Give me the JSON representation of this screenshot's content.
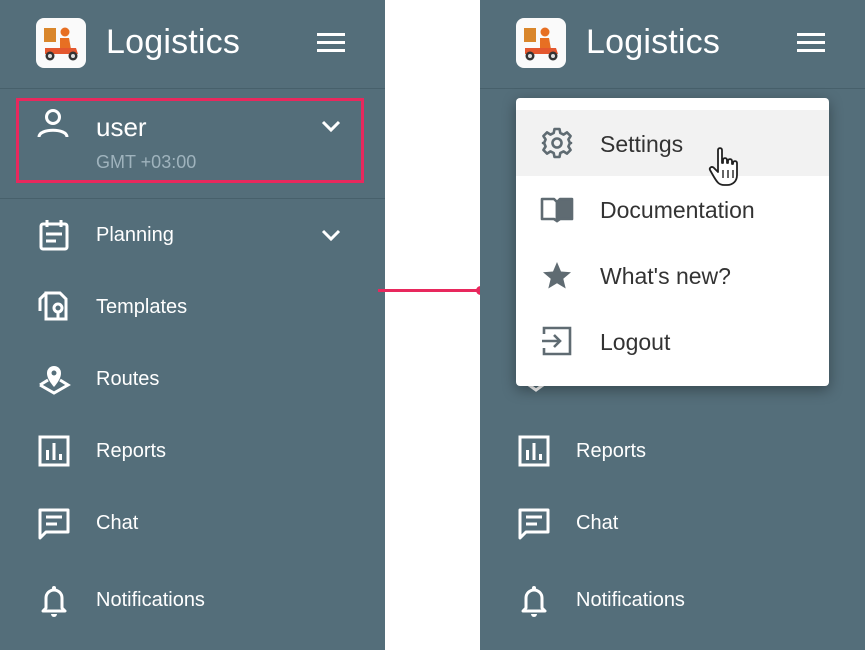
{
  "app": {
    "title": "Logistics"
  },
  "user": {
    "name": "user",
    "timezone": "GMT +03:00"
  },
  "nav": {
    "planning": "Planning",
    "templates": "Templates",
    "routes": "Routes",
    "reports": "Reports",
    "chat": "Chat",
    "notifications": "Notifications"
  },
  "menu": {
    "settings": "Settings",
    "documentation": "Documentation",
    "whats_new": "What's new?",
    "logout": "Logout"
  },
  "colors": {
    "sidebar": "#546e7a",
    "highlight": "#e8285d",
    "menu_text": "#333333",
    "menu_icon": "#5f6b72"
  },
  "icons": {
    "logo": "delivery-scooter-logo",
    "hamburger": "hamburger-icon",
    "user": "person-icon",
    "settings": "gear-icon",
    "documentation": "book-icon",
    "whats_new": "star-icon",
    "logout": "logout-icon"
  }
}
